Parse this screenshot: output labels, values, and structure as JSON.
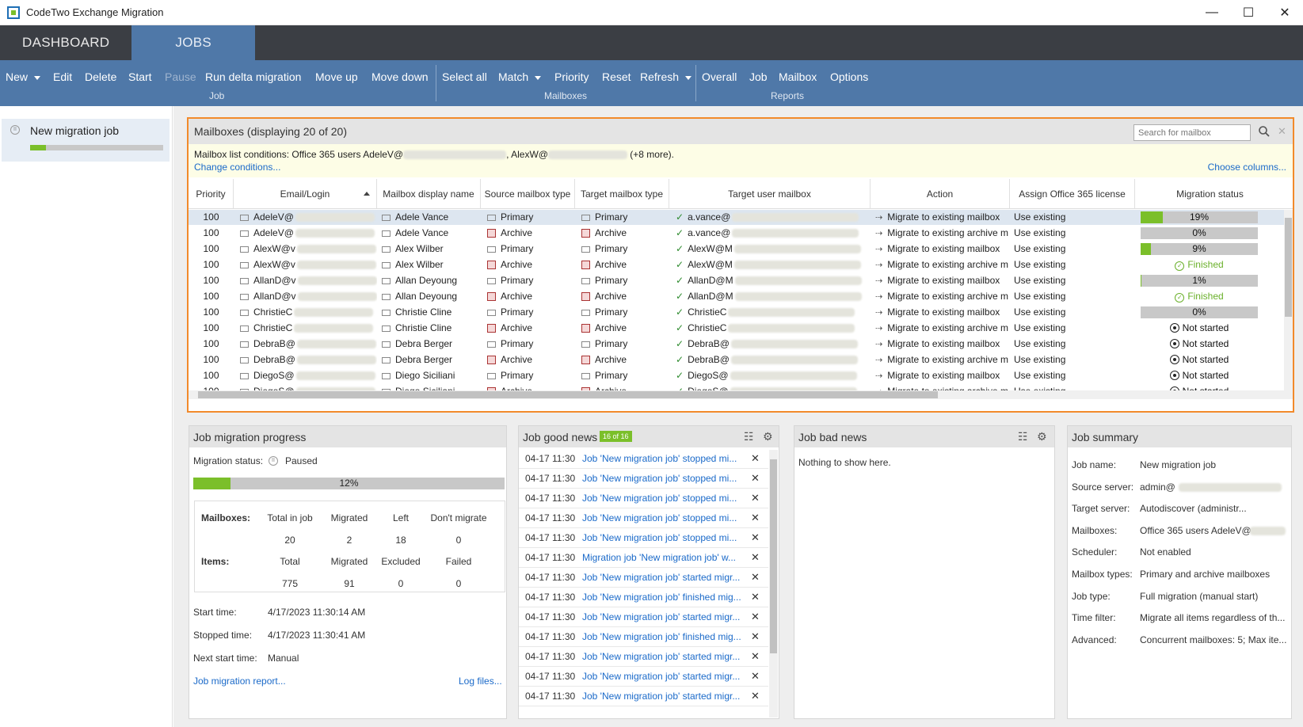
{
  "window": {
    "title": "CodeTwo Exchange Migration",
    "controls": [
      "—",
      "☐",
      "✕"
    ]
  },
  "topnav": {
    "tabs": [
      {
        "label": "DASHBOARD",
        "active": false
      },
      {
        "label": "JOBS",
        "active": true
      }
    ]
  },
  "toolbar": {
    "job_items": [
      "New",
      "Edit",
      "Delete",
      "Start",
      "Pause",
      "Run delta migration",
      "Move up",
      "Move down"
    ],
    "job_group": "Job",
    "mailbox_items": [
      "Select all",
      "Match",
      "Priority",
      "Reset",
      "Refresh"
    ],
    "mailbox_group": "Mailboxes",
    "report_items": [
      "Overall",
      "Job",
      "Mailbox",
      "Options"
    ],
    "report_group": "Reports"
  },
  "sidebar": {
    "jobs": [
      {
        "name": "New migration job",
        "progress": 0.12
      }
    ]
  },
  "mailboxes": {
    "title": "Mailboxes (displaying 20 of 20)",
    "search_placeholder": "Search for mailbox",
    "conditions_prefix": "Mailbox list conditions: Office 365 users AdeleV@",
    "conditions_mid": ", AlexW@",
    "conditions_suffix": " (+8 more).",
    "change_conditions": "Change conditions...",
    "choose_columns": "Choose columns...",
    "columns": [
      "Priority",
      "Email/Login",
      "Mailbox display name",
      "Source mailbox type",
      "Target mailbox type",
      "Target user mailbox",
      "Action",
      "Assign Office 365 license",
      "Migration status"
    ],
    "rows": [
      {
        "priority": "100",
        "email": "AdeleV@",
        "display": "Adele Vance",
        "source": "Primary",
        "target": "Primary",
        "target_user": "a.vance@",
        "action": "Migrate to existing mailbox",
        "license": "Use existing",
        "status_type": "progress",
        "progress": 19,
        "status": "19%"
      },
      {
        "priority": "100",
        "email": "AdeleV@",
        "display": "Adele Vance",
        "source": "Archive",
        "target": "Archive",
        "target_user": "a.vance@",
        "action": "Migrate to existing archive m",
        "license": "Use existing",
        "status_type": "progress",
        "progress": 0,
        "status": "0%"
      },
      {
        "priority": "100",
        "email": "AlexW@v",
        "display": "Alex Wilber",
        "source": "Primary",
        "target": "Primary",
        "target_user": "AlexW@M",
        "action": "Migrate to existing mailbox",
        "license": "Use existing",
        "status_type": "progress",
        "progress": 9,
        "status": "9%"
      },
      {
        "priority": "100",
        "email": "AlexW@v",
        "display": "Alex Wilber",
        "source": "Archive",
        "target": "Archive",
        "target_user": "AlexW@M",
        "action": "Migrate to existing archive m",
        "license": "Use existing",
        "status_type": "finished",
        "status": "Finished"
      },
      {
        "priority": "100",
        "email": "AllanD@v",
        "display": "Allan Deyoung",
        "source": "Primary",
        "target": "Primary",
        "target_user": "AllanD@M",
        "action": "Migrate to existing mailbox",
        "license": "Use existing",
        "status_type": "progress",
        "progress": 1,
        "status": "1%"
      },
      {
        "priority": "100",
        "email": "AllanD@v",
        "display": "Allan Deyoung",
        "source": "Archive",
        "target": "Archive",
        "target_user": "AllanD@M",
        "action": "Migrate to existing archive m",
        "license": "Use existing",
        "status_type": "finished",
        "status": "Finished"
      },
      {
        "priority": "100",
        "email": "ChristieC",
        "display": "Christie Cline",
        "source": "Primary",
        "target": "Primary",
        "target_user": "ChristieC",
        "action": "Migrate to existing mailbox",
        "license": "Use existing",
        "status_type": "progress",
        "progress": 0,
        "status": "0%"
      },
      {
        "priority": "100",
        "email": "ChristieC",
        "display": "Christie Cline",
        "source": "Archive",
        "target": "Archive",
        "target_user": "ChristieC",
        "action": "Migrate to existing archive m",
        "license": "Use existing",
        "status_type": "notstarted",
        "status": "Not started"
      },
      {
        "priority": "100",
        "email": "DebraB@",
        "display": "Debra Berger",
        "source": "Primary",
        "target": "Primary",
        "target_user": "DebraB@",
        "action": "Migrate to existing mailbox",
        "license": "Use existing",
        "status_type": "notstarted",
        "status": "Not started"
      },
      {
        "priority": "100",
        "email": "DebraB@",
        "display": "Debra Berger",
        "source": "Archive",
        "target": "Archive",
        "target_user": "DebraB@",
        "action": "Migrate to existing archive m",
        "license": "Use existing",
        "status_type": "notstarted",
        "status": "Not started"
      },
      {
        "priority": "100",
        "email": "DiegoS@",
        "display": "Diego Siciliani",
        "source": "Primary",
        "target": "Primary",
        "target_user": "DiegoS@",
        "action": "Migrate to existing mailbox",
        "license": "Use existing",
        "status_type": "notstarted",
        "status": "Not started"
      },
      {
        "priority": "100",
        "email": "DiegoS@",
        "display": "Diego Siciliani",
        "source": "Archive",
        "target": "Archive",
        "target_user": "DiegoS@",
        "action": "Migrate to existing archive m",
        "license": "Use existing",
        "status_type": "notstarted",
        "status": "Not started"
      }
    ]
  },
  "progress_panel": {
    "title": "Job migration progress",
    "status_label": "Migration status:",
    "status_value": "Paused",
    "overall_percent": 12,
    "overall_text": "12%",
    "mailboxes_label": "Mailboxes:",
    "mailbox_cols": [
      "Total in job",
      "Migrated",
      "Left",
      "Don't migrate"
    ],
    "mailbox_vals": [
      "20",
      "2",
      "18",
      "0"
    ],
    "items_label": "Items:",
    "item_cols": [
      "Total",
      "Migrated",
      "Excluded",
      "Failed"
    ],
    "item_vals": [
      "775",
      "91",
      "0",
      "0"
    ],
    "start_label": "Start time:",
    "start_value": "4/17/2023 11:30:14 AM",
    "stopped_label": "Stopped time:",
    "stopped_value": "4/17/2023 11:30:41 AM",
    "next_label": "Next start time:",
    "next_value": "Manual",
    "report_link": "Job migration report...",
    "log_link": "Log files..."
  },
  "good_news": {
    "title": "Job good news",
    "badge": "16 of 16",
    "items": [
      {
        "time": "04-17 11:30",
        "text": "Job 'New migration job' stopped mi..."
      },
      {
        "time": "04-17 11:30",
        "text": "Job 'New migration job' stopped mi..."
      },
      {
        "time": "04-17 11:30",
        "text": "Job 'New migration job' stopped mi..."
      },
      {
        "time": "04-17 11:30",
        "text": "Job 'New migration job' stopped mi..."
      },
      {
        "time": "04-17 11:30",
        "text": "Job 'New migration job' stopped mi..."
      },
      {
        "time": "04-17 11:30",
        "text": "Migration job 'New migration job' w..."
      },
      {
        "time": "04-17 11:30",
        "text": "Job 'New migration job' started migr..."
      },
      {
        "time": "04-17 11:30",
        "text": "Job 'New migration job' finished mig..."
      },
      {
        "time": "04-17 11:30",
        "text": "Job 'New migration job' started migr..."
      },
      {
        "time": "04-17 11:30",
        "text": "Job 'New migration job' finished mig..."
      },
      {
        "time": "04-17 11:30",
        "text": "Job 'New migration job' started migr..."
      },
      {
        "time": "04-17 11:30",
        "text": "Job 'New migration job' started migr..."
      },
      {
        "time": "04-17 11:30",
        "text": "Job 'New migration job' started migr..."
      }
    ]
  },
  "bad_news": {
    "title": "Job bad news",
    "empty": "Nothing to show here."
  },
  "summary": {
    "title": "Job summary",
    "rows": [
      {
        "label": "Job name:",
        "value": "New migration job"
      },
      {
        "label": "Source server:",
        "value": "admin@"
      },
      {
        "label": "Target server:",
        "value": "Autodiscover (administr..."
      },
      {
        "label": "Mailboxes:",
        "value": "Office 365 users AdeleV@"
      },
      {
        "label": "Scheduler:",
        "value": "Not enabled"
      },
      {
        "label": "Mailbox types:",
        "value": "Primary and archive mailboxes"
      },
      {
        "label": "Job type:",
        "value": "Full migration (manual start)"
      },
      {
        "label": "Time filter:",
        "value": "Migrate all items regardless of th..."
      },
      {
        "label": "Advanced:",
        "value": "Concurrent mailboxes: 5; Max ite..."
      }
    ]
  }
}
